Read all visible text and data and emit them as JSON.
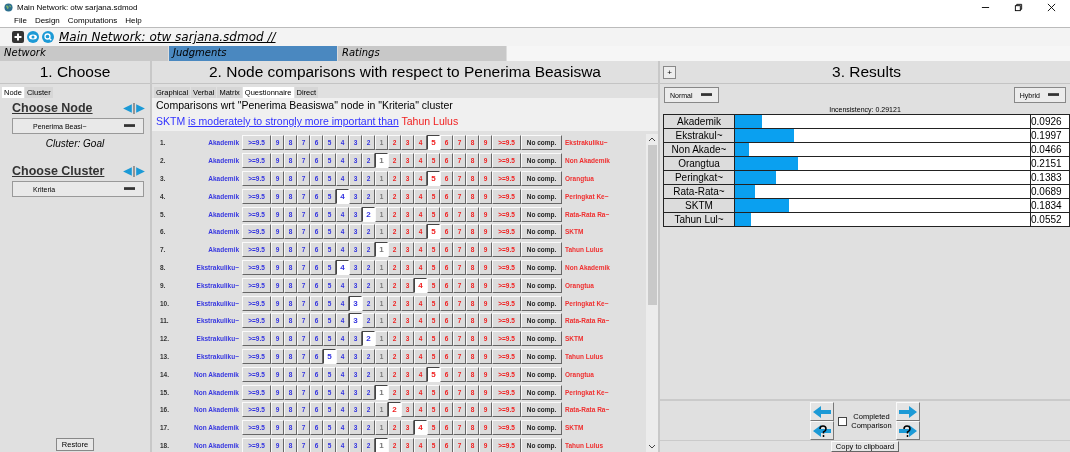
{
  "window": {
    "title": "Main Network: otw sarjana.sdmod"
  },
  "menu": [
    "File",
    "Design",
    "Computations",
    "Help"
  ],
  "network_title": "Main Network: otw sarjana.sdmod //",
  "mode_tabs": [
    {
      "label": "Network",
      "selected": false
    },
    {
      "label": "Judgments",
      "selected": true
    },
    {
      "label": "Ratings",
      "selected": false
    }
  ],
  "choose": {
    "heading": "1. Choose",
    "tabs": [
      {
        "label": "Node",
        "selected": true
      },
      {
        "label": "Cluster",
        "selected": false
      }
    ],
    "node_label": "Choose Node",
    "node_value": "Penerima Beasi~",
    "cluster_note": "Cluster: Goal",
    "cluster_label": "Choose Cluster",
    "cluster_value": "Kriteria",
    "restore": "Restore"
  },
  "comparisons": {
    "heading": "2. Node comparisons with respect to Penerima Beasiswa",
    "tabs": [
      {
        "label": "Graphical",
        "selected": false
      },
      {
        "label": "Verbal",
        "selected": false
      },
      {
        "label": "Matrix",
        "selected": false
      },
      {
        "label": "Questionnaire",
        "selected": true
      },
      {
        "label": "Direct",
        "selected": false
      }
    ],
    "caption": "Comparisons wrt \"Penerima Beasiswa\" node in \"Kriteria\" cluster",
    "verdict": {
      "left": "SKTM",
      "phrase": "is moderately to strongly more important than",
      "right": "Tahun Lulus"
    },
    "rows": [
      {
        "number": "1.",
        "left": "Akademik",
        "buttons": [
          {
            "label": ">=9.5",
            "selected": false
          },
          {
            "label": "9",
            "selected": false
          },
          {
            "label": "8",
            "selected": false
          },
          {
            "label": "7",
            "selected": false
          },
          {
            "label": "6",
            "selected": false
          },
          {
            "label": "5",
            "selected": false
          },
          {
            "label": "4",
            "selected": false
          },
          {
            "label": "3",
            "selected": false
          },
          {
            "label": "2",
            "selected": false
          },
          {
            "label": "1",
            "selected": false
          },
          {
            "label": "2",
            "selected": false
          },
          {
            "label": "3",
            "selected": false
          },
          {
            "label": "4",
            "selected": false
          },
          {
            "label": "5",
            "selected": true
          },
          {
            "label": "6",
            "selected": false
          },
          {
            "label": "7",
            "selected": false
          },
          {
            "label": "8",
            "selected": false
          },
          {
            "label": "9",
            "selected": false
          },
          {
            "label": ">=9.5",
            "selected": false
          }
        ],
        "no_comp": "No comp.",
        "right": "Ekstrakuliku~"
      },
      {
        "number": "2.",
        "left": "Akademik",
        "buttons": [
          {
            "label": ">=9.5",
            "selected": false
          },
          {
            "label": "9",
            "selected": false
          },
          {
            "label": "8",
            "selected": false
          },
          {
            "label": "7",
            "selected": false
          },
          {
            "label": "6",
            "selected": false
          },
          {
            "label": "5",
            "selected": false
          },
          {
            "label": "4",
            "selected": false
          },
          {
            "label": "3",
            "selected": false
          },
          {
            "label": "2",
            "selected": false
          },
          {
            "label": "1",
            "selected": true
          },
          {
            "label": "2",
            "selected": false
          },
          {
            "label": "3",
            "selected": false
          },
          {
            "label": "4",
            "selected": false
          },
          {
            "label": "5",
            "selected": false
          },
          {
            "label": "6",
            "selected": false
          },
          {
            "label": "7",
            "selected": false
          },
          {
            "label": "8",
            "selected": false
          },
          {
            "label": "9",
            "selected": false
          },
          {
            "label": ">=9.5",
            "selected": false
          }
        ],
        "no_comp": "No comp.",
        "right": "Non Akademik"
      },
      {
        "number": "3.",
        "left": "Akademik",
        "buttons": [
          {
            "label": ">=9.5",
            "selected": false
          },
          {
            "label": "9",
            "selected": false
          },
          {
            "label": "8",
            "selected": false
          },
          {
            "label": "7",
            "selected": false
          },
          {
            "label": "6",
            "selected": false
          },
          {
            "label": "5",
            "selected": false
          },
          {
            "label": "4",
            "selected": false
          },
          {
            "label": "3",
            "selected": false
          },
          {
            "label": "2",
            "selected": false
          },
          {
            "label": "1",
            "selected": false
          },
          {
            "label": "2",
            "selected": false
          },
          {
            "label": "3",
            "selected": false
          },
          {
            "label": "4",
            "selected": false
          },
          {
            "label": "5",
            "selected": true
          },
          {
            "label": "6",
            "selected": false
          },
          {
            "label": "7",
            "selected": false
          },
          {
            "label": "8",
            "selected": false
          },
          {
            "label": "9",
            "selected": false
          },
          {
            "label": ">=9.5",
            "selected": false
          }
        ],
        "no_comp": "No comp.",
        "right": "Orangtua"
      },
      {
        "number": "4.",
        "left": "Akademik",
        "buttons": [
          {
            "label": ">=9.5",
            "selected": false
          },
          {
            "label": "9",
            "selected": false
          },
          {
            "label": "8",
            "selected": false
          },
          {
            "label": "7",
            "selected": false
          },
          {
            "label": "6",
            "selected": false
          },
          {
            "label": "5",
            "selected": false
          },
          {
            "label": "4",
            "selected": true
          },
          {
            "label": "3",
            "selected": false
          },
          {
            "label": "2",
            "selected": false
          },
          {
            "label": "1",
            "selected": false
          },
          {
            "label": "2",
            "selected": false
          },
          {
            "label": "3",
            "selected": false
          },
          {
            "label": "4",
            "selected": false
          },
          {
            "label": "5",
            "selected": false
          },
          {
            "label": "6",
            "selected": false
          },
          {
            "label": "7",
            "selected": false
          },
          {
            "label": "8",
            "selected": false
          },
          {
            "label": "9",
            "selected": false
          },
          {
            "label": ">=9.5",
            "selected": false
          }
        ],
        "no_comp": "No comp.",
        "right": "Peringkat Ke~"
      },
      {
        "number": "5.",
        "left": "Akademik",
        "buttons": [
          {
            "label": ">=9.5",
            "selected": false
          },
          {
            "label": "9",
            "selected": false
          },
          {
            "label": "8",
            "selected": false
          },
          {
            "label": "7",
            "selected": false
          },
          {
            "label": "6",
            "selected": false
          },
          {
            "label": "5",
            "selected": false
          },
          {
            "label": "4",
            "selected": false
          },
          {
            "label": "3",
            "selected": false
          },
          {
            "label": "2",
            "selected": true
          },
          {
            "label": "1",
            "selected": false
          },
          {
            "label": "2",
            "selected": false
          },
          {
            "label": "3",
            "selected": false
          },
          {
            "label": "4",
            "selected": false
          },
          {
            "label": "5",
            "selected": false
          },
          {
            "label": "6",
            "selected": false
          },
          {
            "label": "7",
            "selected": false
          },
          {
            "label": "8",
            "selected": false
          },
          {
            "label": "9",
            "selected": false
          },
          {
            "label": ">=9.5",
            "selected": false
          }
        ],
        "no_comp": "No comp.",
        "right": "Rata-Rata Ra~"
      },
      {
        "number": "6.",
        "left": "Akademik",
        "buttons": [
          {
            "label": ">=9.5",
            "selected": false
          },
          {
            "label": "9",
            "selected": false
          },
          {
            "label": "8",
            "selected": false
          },
          {
            "label": "7",
            "selected": false
          },
          {
            "label": "6",
            "selected": false
          },
          {
            "label": "5",
            "selected": false
          },
          {
            "label": "4",
            "selected": false
          },
          {
            "label": "3",
            "selected": false
          },
          {
            "label": "2",
            "selected": false
          },
          {
            "label": "1",
            "selected": false
          },
          {
            "label": "2",
            "selected": false
          },
          {
            "label": "3",
            "selected": false
          },
          {
            "label": "4",
            "selected": false
          },
          {
            "label": "5",
            "selected": true
          },
          {
            "label": "6",
            "selected": false
          },
          {
            "label": "7",
            "selected": false
          },
          {
            "label": "8",
            "selected": false
          },
          {
            "label": "9",
            "selected": false
          },
          {
            "label": ">=9.5",
            "selected": false
          }
        ],
        "no_comp": "No comp.",
        "right": "SKTM"
      },
      {
        "number": "7.",
        "left": "Akademik",
        "buttons": [
          {
            "label": ">=9.5",
            "selected": false
          },
          {
            "label": "9",
            "selected": false
          },
          {
            "label": "8",
            "selected": false
          },
          {
            "label": "7",
            "selected": false
          },
          {
            "label": "6",
            "selected": false
          },
          {
            "label": "5",
            "selected": false
          },
          {
            "label": "4",
            "selected": false
          },
          {
            "label": "3",
            "selected": false
          },
          {
            "label": "2",
            "selected": false
          },
          {
            "label": "1",
            "selected": true
          },
          {
            "label": "2",
            "selected": false
          },
          {
            "label": "3",
            "selected": false
          },
          {
            "label": "4",
            "selected": false
          },
          {
            "label": "5",
            "selected": false
          },
          {
            "label": "6",
            "selected": false
          },
          {
            "label": "7",
            "selected": false
          },
          {
            "label": "8",
            "selected": false
          },
          {
            "label": "9",
            "selected": false
          },
          {
            "label": ">=9.5",
            "selected": false
          }
        ],
        "no_comp": "No comp.",
        "right": "Tahun Lulus"
      },
      {
        "number": "8.",
        "left": "Ekstrakuliku~",
        "buttons": [
          {
            "label": ">=9.5",
            "selected": false
          },
          {
            "label": "9",
            "selected": false
          },
          {
            "label": "8",
            "selected": false
          },
          {
            "label": "7",
            "selected": false
          },
          {
            "label": "6",
            "selected": false
          },
          {
            "label": "5",
            "selected": false
          },
          {
            "label": "4",
            "selected": true
          },
          {
            "label": "3",
            "selected": false
          },
          {
            "label": "2",
            "selected": false
          },
          {
            "label": "1",
            "selected": false
          },
          {
            "label": "2",
            "selected": false
          },
          {
            "label": "3",
            "selected": false
          },
          {
            "label": "4",
            "selected": false
          },
          {
            "label": "5",
            "selected": false
          },
          {
            "label": "6",
            "selected": false
          },
          {
            "label": "7",
            "selected": false
          },
          {
            "label": "8",
            "selected": false
          },
          {
            "label": "9",
            "selected": false
          },
          {
            "label": ">=9.5",
            "selected": false
          }
        ],
        "no_comp": "No comp.",
        "right": "Non Akademik"
      },
      {
        "number": "9.",
        "left": "Ekstrakuliku~",
        "buttons": [
          {
            "label": ">=9.5",
            "selected": false
          },
          {
            "label": "9",
            "selected": false
          },
          {
            "label": "8",
            "selected": false
          },
          {
            "label": "7",
            "selected": false
          },
          {
            "label": "6",
            "selected": false
          },
          {
            "label": "5",
            "selected": false
          },
          {
            "label": "4",
            "selected": false
          },
          {
            "label": "3",
            "selected": false
          },
          {
            "label": "2",
            "selected": false
          },
          {
            "label": "1",
            "selected": false
          },
          {
            "label": "2",
            "selected": false
          },
          {
            "label": "3",
            "selected": false
          },
          {
            "label": "4",
            "selected": true
          },
          {
            "label": "5",
            "selected": false
          },
          {
            "label": "6",
            "selected": false
          },
          {
            "label": "7",
            "selected": false
          },
          {
            "label": "8",
            "selected": false
          },
          {
            "label": "9",
            "selected": false
          },
          {
            "label": ">=9.5",
            "selected": false
          }
        ],
        "no_comp": "No comp.",
        "right": "Orangtua"
      },
      {
        "number": "10.",
        "left": "Ekstrakuliku~",
        "buttons": [
          {
            "label": ">=9.5",
            "selected": false
          },
          {
            "label": "9",
            "selected": false
          },
          {
            "label": "8",
            "selected": false
          },
          {
            "label": "7",
            "selected": false
          },
          {
            "label": "6",
            "selected": false
          },
          {
            "label": "5",
            "selected": false
          },
          {
            "label": "4",
            "selected": false
          },
          {
            "label": "3",
            "selected": true
          },
          {
            "label": "2",
            "selected": false
          },
          {
            "label": "1",
            "selected": false
          },
          {
            "label": "2",
            "selected": false
          },
          {
            "label": "3",
            "selected": false
          },
          {
            "label": "4",
            "selected": false
          },
          {
            "label": "5",
            "selected": false
          },
          {
            "label": "6",
            "selected": false
          },
          {
            "label": "7",
            "selected": false
          },
          {
            "label": "8",
            "selected": false
          },
          {
            "label": "9",
            "selected": false
          },
          {
            "label": ">=9.5",
            "selected": false
          }
        ],
        "no_comp": "No comp.",
        "right": "Peringkat Ke~"
      },
      {
        "number": "11.",
        "left": "Ekstrakuliku~",
        "buttons": [
          {
            "label": ">=9.5",
            "selected": false
          },
          {
            "label": "9",
            "selected": false
          },
          {
            "label": "8",
            "selected": false
          },
          {
            "label": "7",
            "selected": false
          },
          {
            "label": "6",
            "selected": false
          },
          {
            "label": "5",
            "selected": false
          },
          {
            "label": "4",
            "selected": false
          },
          {
            "label": "3",
            "selected": true
          },
          {
            "label": "2",
            "selected": false
          },
          {
            "label": "1",
            "selected": false
          },
          {
            "label": "2",
            "selected": false
          },
          {
            "label": "3",
            "selected": false
          },
          {
            "label": "4",
            "selected": false
          },
          {
            "label": "5",
            "selected": false
          },
          {
            "label": "6",
            "selected": false
          },
          {
            "label": "7",
            "selected": false
          },
          {
            "label": "8",
            "selected": false
          },
          {
            "label": "9",
            "selected": false
          },
          {
            "label": ">=9.5",
            "selected": false
          }
        ],
        "no_comp": "No comp.",
        "right": "Rata-Rata Ra~"
      },
      {
        "number": "12.",
        "left": "Ekstrakuliku~",
        "buttons": [
          {
            "label": ">=9.5",
            "selected": false
          },
          {
            "label": "9",
            "selected": false
          },
          {
            "label": "8",
            "selected": false
          },
          {
            "label": "7",
            "selected": false
          },
          {
            "label": "6",
            "selected": false
          },
          {
            "label": "5",
            "selected": false
          },
          {
            "label": "4",
            "selected": false
          },
          {
            "label": "3",
            "selected": false
          },
          {
            "label": "2",
            "selected": true
          },
          {
            "label": "1",
            "selected": false
          },
          {
            "label": "2",
            "selected": false
          },
          {
            "label": "3",
            "selected": false
          },
          {
            "label": "4",
            "selected": false
          },
          {
            "label": "5",
            "selected": false
          },
          {
            "label": "6",
            "selected": false
          },
          {
            "label": "7",
            "selected": false
          },
          {
            "label": "8",
            "selected": false
          },
          {
            "label": "9",
            "selected": false
          },
          {
            "label": ">=9.5",
            "selected": false
          }
        ],
        "no_comp": "No comp.",
        "right": "SKTM"
      },
      {
        "number": "13.",
        "left": "Ekstrakuliku~",
        "buttons": [
          {
            "label": ">=9.5",
            "selected": false
          },
          {
            "label": "9",
            "selected": false
          },
          {
            "label": "8",
            "selected": false
          },
          {
            "label": "7",
            "selected": false
          },
          {
            "label": "6",
            "selected": false
          },
          {
            "label": "5",
            "selected": true
          },
          {
            "label": "4",
            "selected": false
          },
          {
            "label": "3",
            "selected": false
          },
          {
            "label": "2",
            "selected": false
          },
          {
            "label": "1",
            "selected": false
          },
          {
            "label": "2",
            "selected": false
          },
          {
            "label": "3",
            "selected": false
          },
          {
            "label": "4",
            "selected": false
          },
          {
            "label": "5",
            "selected": false
          },
          {
            "label": "6",
            "selected": false
          },
          {
            "label": "7",
            "selected": false
          },
          {
            "label": "8",
            "selected": false
          },
          {
            "label": "9",
            "selected": false
          },
          {
            "label": ">=9.5",
            "selected": false
          }
        ],
        "no_comp": "No comp.",
        "right": "Tahun Lulus"
      },
      {
        "number": "14.",
        "left": "Non Akademik",
        "buttons": [
          {
            "label": ">=9.5",
            "selected": false
          },
          {
            "label": "9",
            "selected": false
          },
          {
            "label": "8",
            "selected": false
          },
          {
            "label": "7",
            "selected": false
          },
          {
            "label": "6",
            "selected": false
          },
          {
            "label": "5",
            "selected": false
          },
          {
            "label": "4",
            "selected": false
          },
          {
            "label": "3",
            "selected": false
          },
          {
            "label": "2",
            "selected": false
          },
          {
            "label": "1",
            "selected": false
          },
          {
            "label": "2",
            "selected": false
          },
          {
            "label": "3",
            "selected": false
          },
          {
            "label": "4",
            "selected": false
          },
          {
            "label": "5",
            "selected": true
          },
          {
            "label": "6",
            "selected": false
          },
          {
            "label": "7",
            "selected": false
          },
          {
            "label": "8",
            "selected": false
          },
          {
            "label": "9",
            "selected": false
          },
          {
            "label": ">=9.5",
            "selected": false
          }
        ],
        "no_comp": "No comp.",
        "right": "Orangtua"
      },
      {
        "number": "15.",
        "left": "Non Akademik",
        "buttons": [
          {
            "label": ">=9.5",
            "selected": false
          },
          {
            "label": "9",
            "selected": false
          },
          {
            "label": "8",
            "selected": false
          },
          {
            "label": "7",
            "selected": false
          },
          {
            "label": "6",
            "selected": false
          },
          {
            "label": "5",
            "selected": false
          },
          {
            "label": "4",
            "selected": false
          },
          {
            "label": "3",
            "selected": false
          },
          {
            "label": "2",
            "selected": false
          },
          {
            "label": "1",
            "selected": true
          },
          {
            "label": "2",
            "selected": false
          },
          {
            "label": "3",
            "selected": false
          },
          {
            "label": "4",
            "selected": false
          },
          {
            "label": "5",
            "selected": false
          },
          {
            "label": "6",
            "selected": false
          },
          {
            "label": "7",
            "selected": false
          },
          {
            "label": "8",
            "selected": false
          },
          {
            "label": "9",
            "selected": false
          },
          {
            "label": ">=9.5",
            "selected": false
          }
        ],
        "no_comp": "No comp.",
        "right": "Peringkat Ke~"
      },
      {
        "number": "16.",
        "left": "Non Akademik",
        "buttons": [
          {
            "label": ">=9.5",
            "selected": false
          },
          {
            "label": "9",
            "selected": false
          },
          {
            "label": "8",
            "selected": false
          },
          {
            "label": "7",
            "selected": false
          },
          {
            "label": "6",
            "selected": false
          },
          {
            "label": "5",
            "selected": false
          },
          {
            "label": "4",
            "selected": false
          },
          {
            "label": "3",
            "selected": false
          },
          {
            "label": "2",
            "selected": false
          },
          {
            "label": "1",
            "selected": false
          },
          {
            "label": "2",
            "selected": true
          },
          {
            "label": "3",
            "selected": false
          },
          {
            "label": "4",
            "selected": false
          },
          {
            "label": "5",
            "selected": false
          },
          {
            "label": "6",
            "selected": false
          },
          {
            "label": "7",
            "selected": false
          },
          {
            "label": "8",
            "selected": false
          },
          {
            "label": "9",
            "selected": false
          },
          {
            "label": ">=9.5",
            "selected": false
          }
        ],
        "no_comp": "No comp.",
        "right": "Rata-Rata Ra~"
      },
      {
        "number": "17.",
        "left": "Non Akademik",
        "buttons": [
          {
            "label": ">=9.5",
            "selected": false
          },
          {
            "label": "9",
            "selected": false
          },
          {
            "label": "8",
            "selected": false
          },
          {
            "label": "7",
            "selected": false
          },
          {
            "label": "6",
            "selected": false
          },
          {
            "label": "5",
            "selected": false
          },
          {
            "label": "4",
            "selected": false
          },
          {
            "label": "3",
            "selected": false
          },
          {
            "label": "2",
            "selected": false
          },
          {
            "label": "1",
            "selected": false
          },
          {
            "label": "2",
            "selected": false
          },
          {
            "label": "3",
            "selected": false
          },
          {
            "label": "4",
            "selected": true
          },
          {
            "label": "5",
            "selected": false
          },
          {
            "label": "6",
            "selected": false
          },
          {
            "label": "7",
            "selected": false
          },
          {
            "label": "8",
            "selected": false
          },
          {
            "label": "9",
            "selected": false
          },
          {
            "label": ">=9.5",
            "selected": false
          }
        ],
        "no_comp": "No comp.",
        "right": "SKTM"
      },
      {
        "number": "18.",
        "left": "Non Akademik",
        "buttons": [
          {
            "label": ">=9.5",
            "selected": false
          },
          {
            "label": "9",
            "selected": false
          },
          {
            "label": "8",
            "selected": false
          },
          {
            "label": "7",
            "selected": false
          },
          {
            "label": "6",
            "selected": false
          },
          {
            "label": "5",
            "selected": false
          },
          {
            "label": "4",
            "selected": false
          },
          {
            "label": "3",
            "selected": false
          },
          {
            "label": "2",
            "selected": false
          },
          {
            "label": "1",
            "selected": true
          },
          {
            "label": "2",
            "selected": false
          },
          {
            "label": "3",
            "selected": false
          },
          {
            "label": "4",
            "selected": false
          },
          {
            "label": "5",
            "selected": false
          },
          {
            "label": "6",
            "selected": false
          },
          {
            "label": "7",
            "selected": false
          },
          {
            "label": "8",
            "selected": false
          },
          {
            "label": "9",
            "selected": false
          },
          {
            "label": ">=9.5",
            "selected": false
          }
        ],
        "no_comp": "No comp.",
        "right": "Tahun Lulus"
      }
    ]
  },
  "results": {
    "heading": "3. Results",
    "expand": "+",
    "mode": "Normal",
    "type": "Hybrid",
    "inconsistency": "Incensistency: 0.29121",
    "items": [
      {
        "name": "Akademik",
        "level": 0.093,
        "value": "0.0926"
      },
      {
        "name": "Ekstrakul~",
        "level": 0.2,
        "value": "0.1997"
      },
      {
        "name": "Non Akade~",
        "level": 0.047,
        "value": "0.0466"
      },
      {
        "name": "Orangtua",
        "level": 0.215,
        "value": "0.2151"
      },
      {
        "name": "Peringkat~",
        "level": 0.138,
        "value": "0.1383"
      },
      {
        "name": "Rata-Rata~",
        "level": 0.069,
        "value": "0.0689"
      },
      {
        "name": "SKTM",
        "level": 0.183,
        "value": "0.1834"
      },
      {
        "name": "Tahun Lul~",
        "level": 0.055,
        "value": "0.0552"
      }
    ],
    "completed": {
      "label1": "Completed",
      "label2": "Comparison",
      "checked": false
    },
    "copy": "Copy to clipboard"
  }
}
